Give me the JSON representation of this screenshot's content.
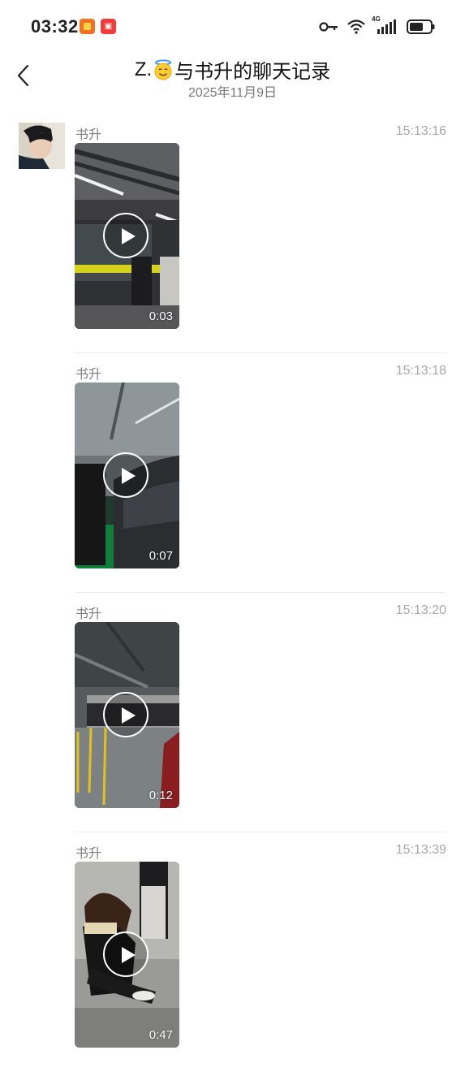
{
  "status_bar": {
    "time": "03:32",
    "network": "4G"
  },
  "header": {
    "title_prefix": "Z.",
    "title_suffix": "与书升的聊天记录",
    "date": "2025年11月9日"
  },
  "messages": [
    {
      "sender": "书升",
      "time": "15:13:16",
      "duration": "0:03"
    },
    {
      "sender": "书升",
      "time": "15:13:18",
      "duration": "0:07"
    },
    {
      "sender": "书升",
      "time": "15:13:20",
      "duration": "0:12"
    },
    {
      "sender": "书升",
      "time": "15:13:39",
      "duration": "0:47"
    }
  ],
  "colors": {
    "time_gray": "#a8a8a8",
    "name_gray": "#7d7d7d",
    "divider": "#ececec"
  }
}
